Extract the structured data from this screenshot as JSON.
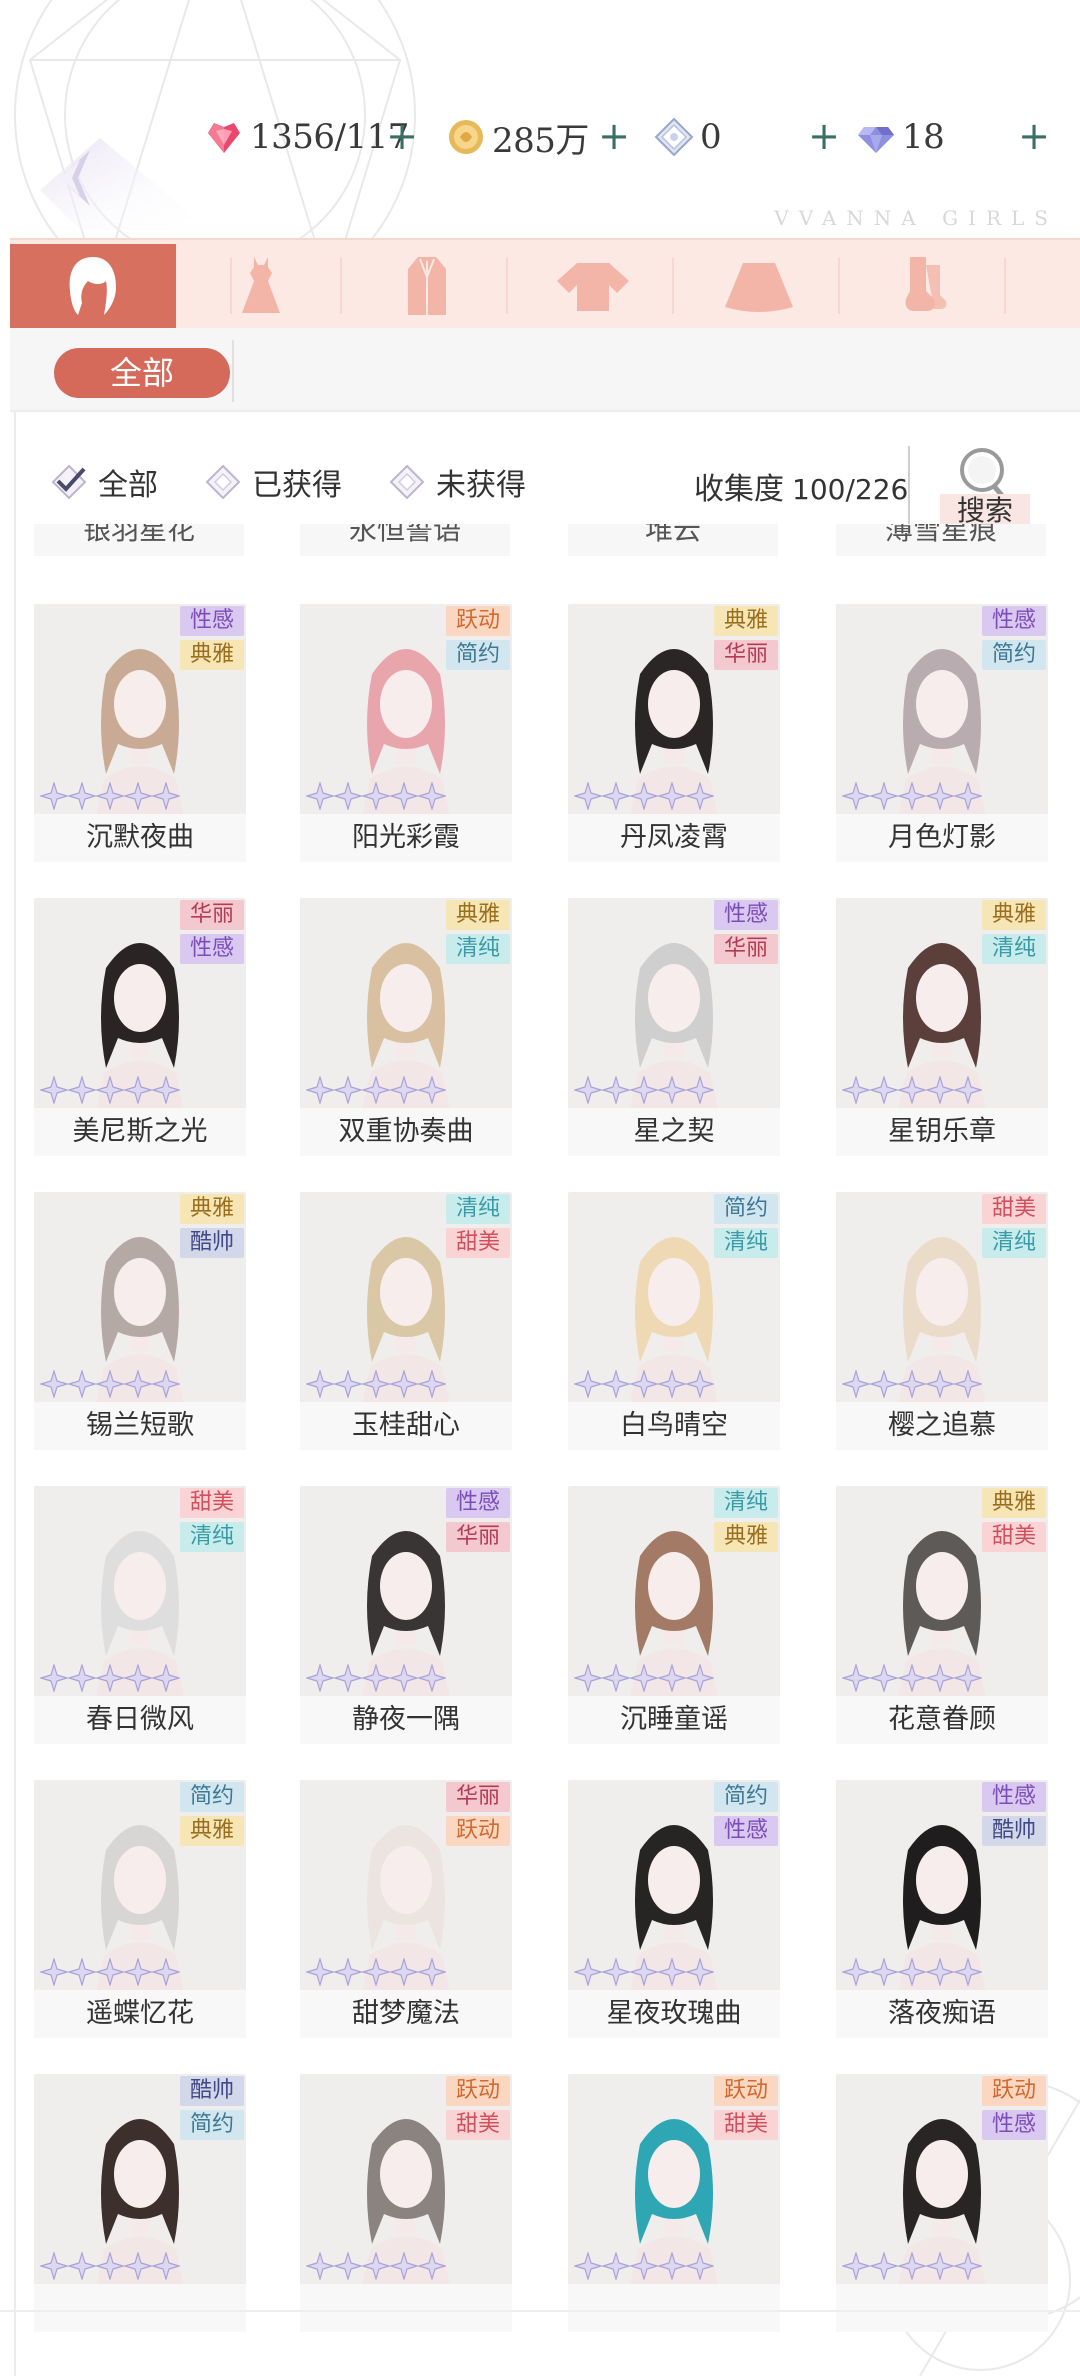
{
  "header": {
    "brand": "VVANNA GIRLS",
    "stamina": "1356/117",
    "coins": "285万",
    "crystal": "0",
    "diamond": "18",
    "plus": "+"
  },
  "categories": [
    "hair",
    "dress",
    "coat",
    "top",
    "skirt",
    "socks"
  ],
  "active_category": "hair",
  "sub_filter": {
    "all_label": "全部"
  },
  "filters": [
    {
      "label": "全部",
      "checked": true
    },
    {
      "label": "已获得",
      "checked": false
    },
    {
      "label": "未获得",
      "checked": false
    }
  ],
  "collection": {
    "label": "收集度",
    "value": "100/226"
  },
  "search_label": "搜索",
  "partial_row": [
    "银羽星花",
    "永恒誓语",
    "堆云",
    "薄雪星痕"
  ],
  "tag_colors": {
    "性感": {
      "bg": "#d9c8f0",
      "fg": "#7c4cb8"
    },
    "典雅": {
      "bg": "#f6e6b6",
      "fg": "#9a6e1e"
    },
    "跃动": {
      "bg": "#fbd7c2",
      "fg": "#d06a2e"
    },
    "简约": {
      "bg": "#d2e6ef",
      "fg": "#3d7893"
    },
    "华丽": {
      "bg": "#f4c8cf",
      "fg": "#b23c53"
    },
    "清纯": {
      "bg": "#c8ecec",
      "fg": "#3a9aa6"
    },
    "酷帅": {
      "bg": "#d3d7ea",
      "fg": "#414a86"
    },
    "甜美": {
      "bg": "#fad3d4",
      "fg": "#d1505d"
    }
  },
  "items": [
    {
      "name": "沉默夜曲",
      "tags": [
        "性感",
        "典雅"
      ],
      "hair": "#c9ab95"
    },
    {
      "name": "阳光彩霞",
      "tags": [
        "跃动",
        "简约"
      ],
      "hair": "#e8a6ac"
    },
    {
      "name": "丹凤凌霄",
      "tags": [
        "典雅",
        "华丽"
      ],
      "hair": "#2b2626"
    },
    {
      "name": "月色灯影",
      "tags": [
        "性感",
        "简约"
      ],
      "hair": "#b9acb0"
    },
    {
      "name": "美尼斯之光",
      "tags": [
        "华丽",
        "性感"
      ],
      "hair": "#2a2524"
    },
    {
      "name": "双重协奏曲",
      "tags": [
        "典雅",
        "清纯"
      ],
      "hair": "#d8c0a0"
    },
    {
      "name": "星之契",
      "tags": [
        "性感",
        "华丽"
      ],
      "hair": "#cfcfcf"
    },
    {
      "name": "星钥乐章",
      "tags": [
        "典雅",
        "清纯"
      ],
      "hair": "#5a3f3b"
    },
    {
      "name": "锡兰短歌",
      "tags": [
        "典雅",
        "酷帅"
      ],
      "hair": "#b5a9a6"
    },
    {
      "name": "玉桂甜心",
      "tags": [
        "清纯",
        "甜美"
      ],
      "hair": "#d9c7a6"
    },
    {
      "name": "白鸟晴空",
      "tags": [
        "简约",
        "清纯"
      ],
      "hair": "#efd9b5"
    },
    {
      "name": "樱之追慕",
      "tags": [
        "甜美",
        "清纯"
      ],
      "hair": "#eadcc8"
    },
    {
      "name": "春日微风",
      "tags": [
        "甜美",
        "清纯"
      ],
      "hair": "#dedede"
    },
    {
      "name": "静夜一隅",
      "tags": [
        "性感",
        "华丽"
      ],
      "hair": "#3a3535"
    },
    {
      "name": "沉睡童谣",
      "tags": [
        "清纯",
        "典雅"
      ],
      "hair": "#a27a66"
    },
    {
      "name": "花意眷顾",
      "tags": [
        "典雅",
        "甜美"
      ],
      "hair": "#5e5a58"
    },
    {
      "name": "遥蝶忆花",
      "tags": [
        "简约",
        "典雅"
      ],
      "hair": "#d8d6d4"
    },
    {
      "name": "甜梦魔法",
      "tags": [
        "华丽",
        "跃动"
      ],
      "hair": "#ece4e0"
    },
    {
      "name": "星夜玫瑰曲",
      "tags": [
        "简约",
        "性感"
      ],
      "hair": "#272424"
    },
    {
      "name": "落夜痴语",
      "tags": [
        "性感",
        "酷帅"
      ],
      "hair": "#1f1d1d"
    },
    {
      "name": "",
      "tags": [
        "酷帅",
        "简约"
      ],
      "hair": "#3d302c"
    },
    {
      "name": "",
      "tags": [
        "跃动",
        "甜美"
      ],
      "hair": "#8a8380"
    },
    {
      "name": "",
      "tags": [
        "跃动",
        "甜美"
      ],
      "hair": "#2ea6b4"
    },
    {
      "name": "",
      "tags": [
        "跃动",
        "性感"
      ],
      "hair": "#2a2525"
    }
  ]
}
